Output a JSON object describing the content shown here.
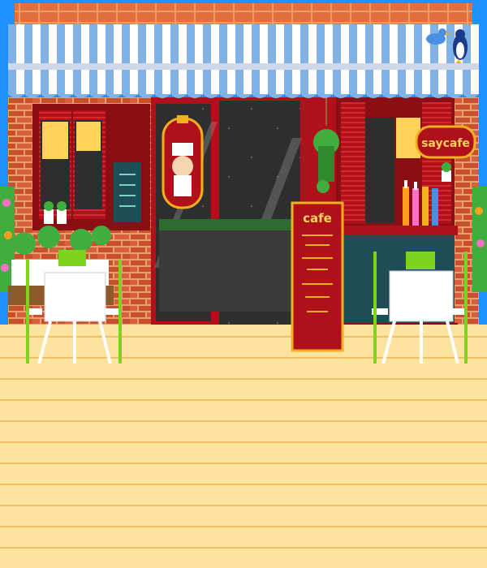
{
  "scene": {
    "shop_sign": "saycafe",
    "menu_board_title": "cafe"
  },
  "colors": {
    "sky": "#1e90ff",
    "brick": "#c8502e",
    "brick_mortar": "#e8a070",
    "awning_blue": "#7fb2e6",
    "awning_white": "#ffffff",
    "wood_red": "#b0101a",
    "window_dark": "#2e2e2e",
    "floor": "#fde3a0",
    "floor_line": "#f0c060",
    "counter_teal": "#1e4d57",
    "gold": "#f0b020",
    "table_white": "#ffffff",
    "plant_green": "#3fae3f",
    "cushion_green": "#7ed321"
  },
  "icons": [
    "bluebird-icon",
    "penguin-icon",
    "chef-portrait-icon",
    "hanging-plant-icon",
    "bottle-icon",
    "potted-plant-icon"
  ]
}
